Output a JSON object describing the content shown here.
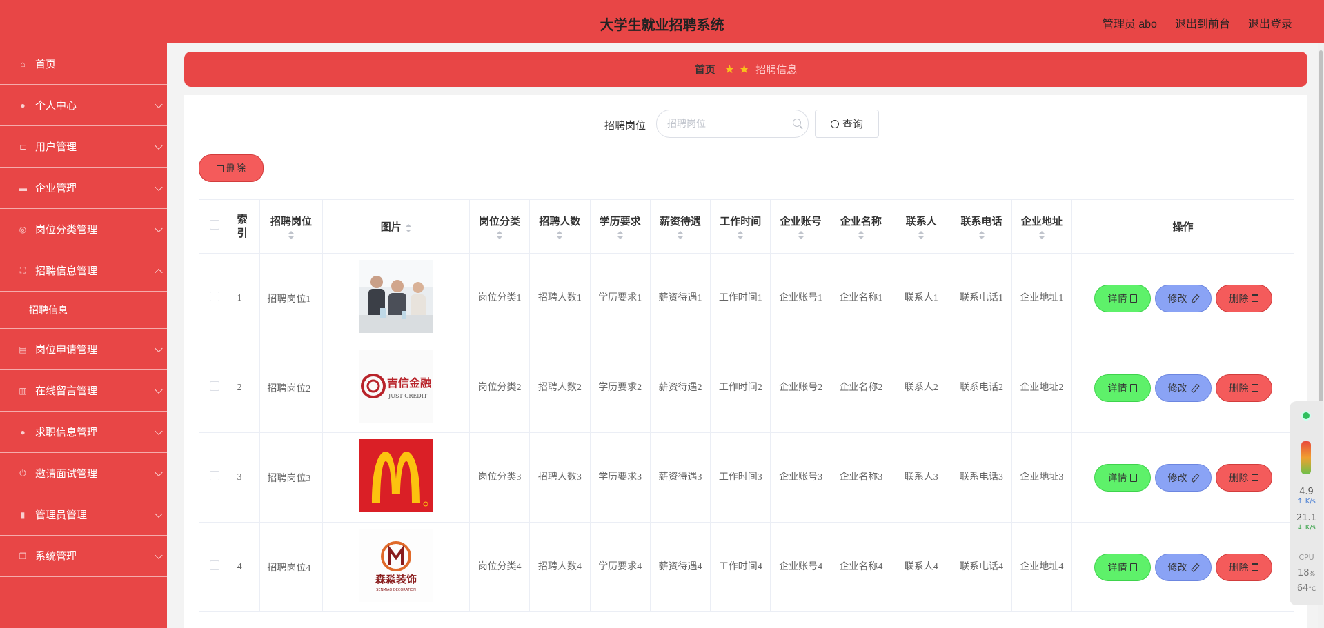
{
  "app": {
    "title": "大学生就业招聘系统",
    "top_links": [
      "管理员 abo",
      "退出到前台",
      "退出登录"
    ]
  },
  "sidebar": {
    "items": [
      {
        "label": "首页",
        "icon": "home-icon",
        "glyph": "⌂",
        "expandable": false
      },
      {
        "label": "个人中心",
        "icon": "user-icon",
        "glyph": "●",
        "expandable": true
      },
      {
        "label": "用户管理",
        "icon": "crop-icon",
        "glyph": "⊏",
        "expandable": true
      },
      {
        "label": "企业管理",
        "icon": "monitor-icon",
        "glyph": "▬",
        "expandable": true
      },
      {
        "label": "岗位分类管理",
        "icon": "aperture-icon",
        "glyph": "◎",
        "expandable": true
      },
      {
        "label": "招聘信息管理",
        "icon": "expand-icon",
        "glyph": "⛶",
        "expandable": true,
        "open": true,
        "children": [
          "招聘信息"
        ]
      },
      {
        "label": "岗位申请管理",
        "icon": "suitcase-icon",
        "glyph": "▤",
        "expandable": true
      },
      {
        "label": "在线留言管理",
        "icon": "clipboard-icon",
        "glyph": "▥",
        "expandable": true
      },
      {
        "label": "求职信息管理",
        "icon": "user-icon",
        "glyph": "●",
        "expandable": true
      },
      {
        "label": "邀请面试管理",
        "icon": "power-icon",
        "glyph": "⏻",
        "expandable": true
      },
      {
        "label": "管理员管理",
        "icon": "bar-chart-icon",
        "glyph": "▮",
        "expandable": true
      },
      {
        "label": "系统管理",
        "icon": "copy-icon",
        "glyph": "❐",
        "expandable": true
      }
    ]
  },
  "breadcrumb": {
    "home": "首页",
    "current": "招聘信息"
  },
  "search": {
    "label": "招聘岗位",
    "placeholder": "招聘岗位",
    "button": "查询"
  },
  "toolbar": {
    "delete_label": "删除"
  },
  "table": {
    "headers": {
      "index": "索引",
      "position": "招聘岗位",
      "image": "图片",
      "category": "岗位分类",
      "count": "招聘人数",
      "education": "学历要求",
      "salary": "薪资待遇",
      "work_time": "工作时间",
      "account": "企业账号",
      "company": "企业名称",
      "contact": "联系人",
      "phone": "联系电话",
      "address": "企业地址",
      "actions": "操作"
    },
    "actions": {
      "detail": "详情",
      "edit": "修改",
      "delete": "删除"
    },
    "rows": [
      {
        "index": "1",
        "position": "招聘岗位1",
        "image": "business-people-photo",
        "category": "岗位分类1",
        "count": "招聘人数1",
        "education": "学历要求1",
        "salary": "薪资待遇1",
        "work_time": "工作时间1",
        "account": "企业账号1",
        "company": "企业名称1",
        "contact": "联系人1",
        "phone": "联系电话1",
        "address": "企业地址1"
      },
      {
        "index": "2",
        "position": "招聘岗位2",
        "image": "just-credit-logo",
        "logo_text": "吉信金融",
        "logo_sub": "JUST CREDIT",
        "category": "岗位分类2",
        "count": "招聘人数2",
        "education": "学历要求2",
        "salary": "薪资待遇2",
        "work_time": "工作时间2",
        "account": "企业账号2",
        "company": "企业名称2",
        "contact": "联系人2",
        "phone": "联系电话2",
        "address": "企业地址2"
      },
      {
        "index": "3",
        "position": "招聘岗位3",
        "image": "mcdonalds-logo",
        "category": "岗位分类3",
        "count": "招聘人数3",
        "education": "学历要求3",
        "salary": "薪资待遇3",
        "work_time": "工作时间3",
        "account": "企业账号3",
        "company": "企业名称3",
        "contact": "联系人3",
        "phone": "联系电话3",
        "address": "企业地址3"
      },
      {
        "index": "4",
        "position": "招聘岗位4",
        "image": "senmiao-decoration-logo",
        "logo_text": "森淼装饰",
        "logo_sub": "SENMIAO DECORATION",
        "category": "岗位分类4",
        "count": "招聘人数4",
        "education": "学历要求4",
        "salary": "薪资待遇4",
        "work_time": "工作时间4",
        "account": "企业账号4",
        "company": "企业名称4",
        "contact": "联系人4",
        "phone": "联系电话4",
        "address": "企业地址4"
      }
    ]
  },
  "monitor": {
    "up": "4.9",
    "down": "21.1",
    "unit": "K/s",
    "cpu_label": "CPU",
    "cpu": "18",
    "cpu_unit": "%",
    "temp": "64",
    "temp_unit": "°C"
  },
  "colors": {
    "primary": "#e84646",
    "detail": "#5ef16a",
    "edit": "#8aa3f5",
    "delete": "#f45b5b",
    "star": "#f8c21a"
  }
}
